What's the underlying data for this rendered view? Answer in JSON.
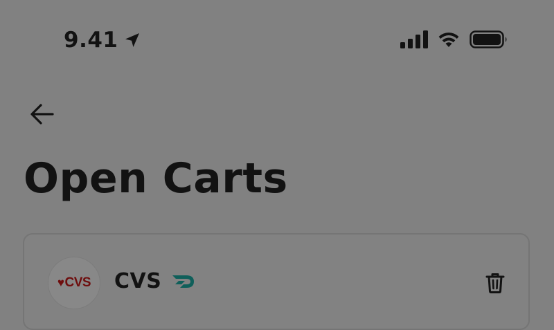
{
  "status_bar": {
    "time": "9.41",
    "icons": [
      "location-arrow-icon",
      "cellular-signal-icon",
      "wifi-icon",
      "battery-icon"
    ]
  },
  "header": {
    "back_icon": "arrow-left-icon",
    "title": "Open Carts"
  },
  "carts": [
    {
      "store_name": "CVS",
      "logo_text": "CVS",
      "logo_icon": "heart-icon",
      "badge_icon": "dashpass-icon",
      "delete_icon": "trash-icon"
    }
  ],
  "colors": {
    "overlay_background": "#818181",
    "text": "#121212",
    "cvs_red": "#6e0d0d",
    "dashpass_teal": "#0f5f5a"
  }
}
